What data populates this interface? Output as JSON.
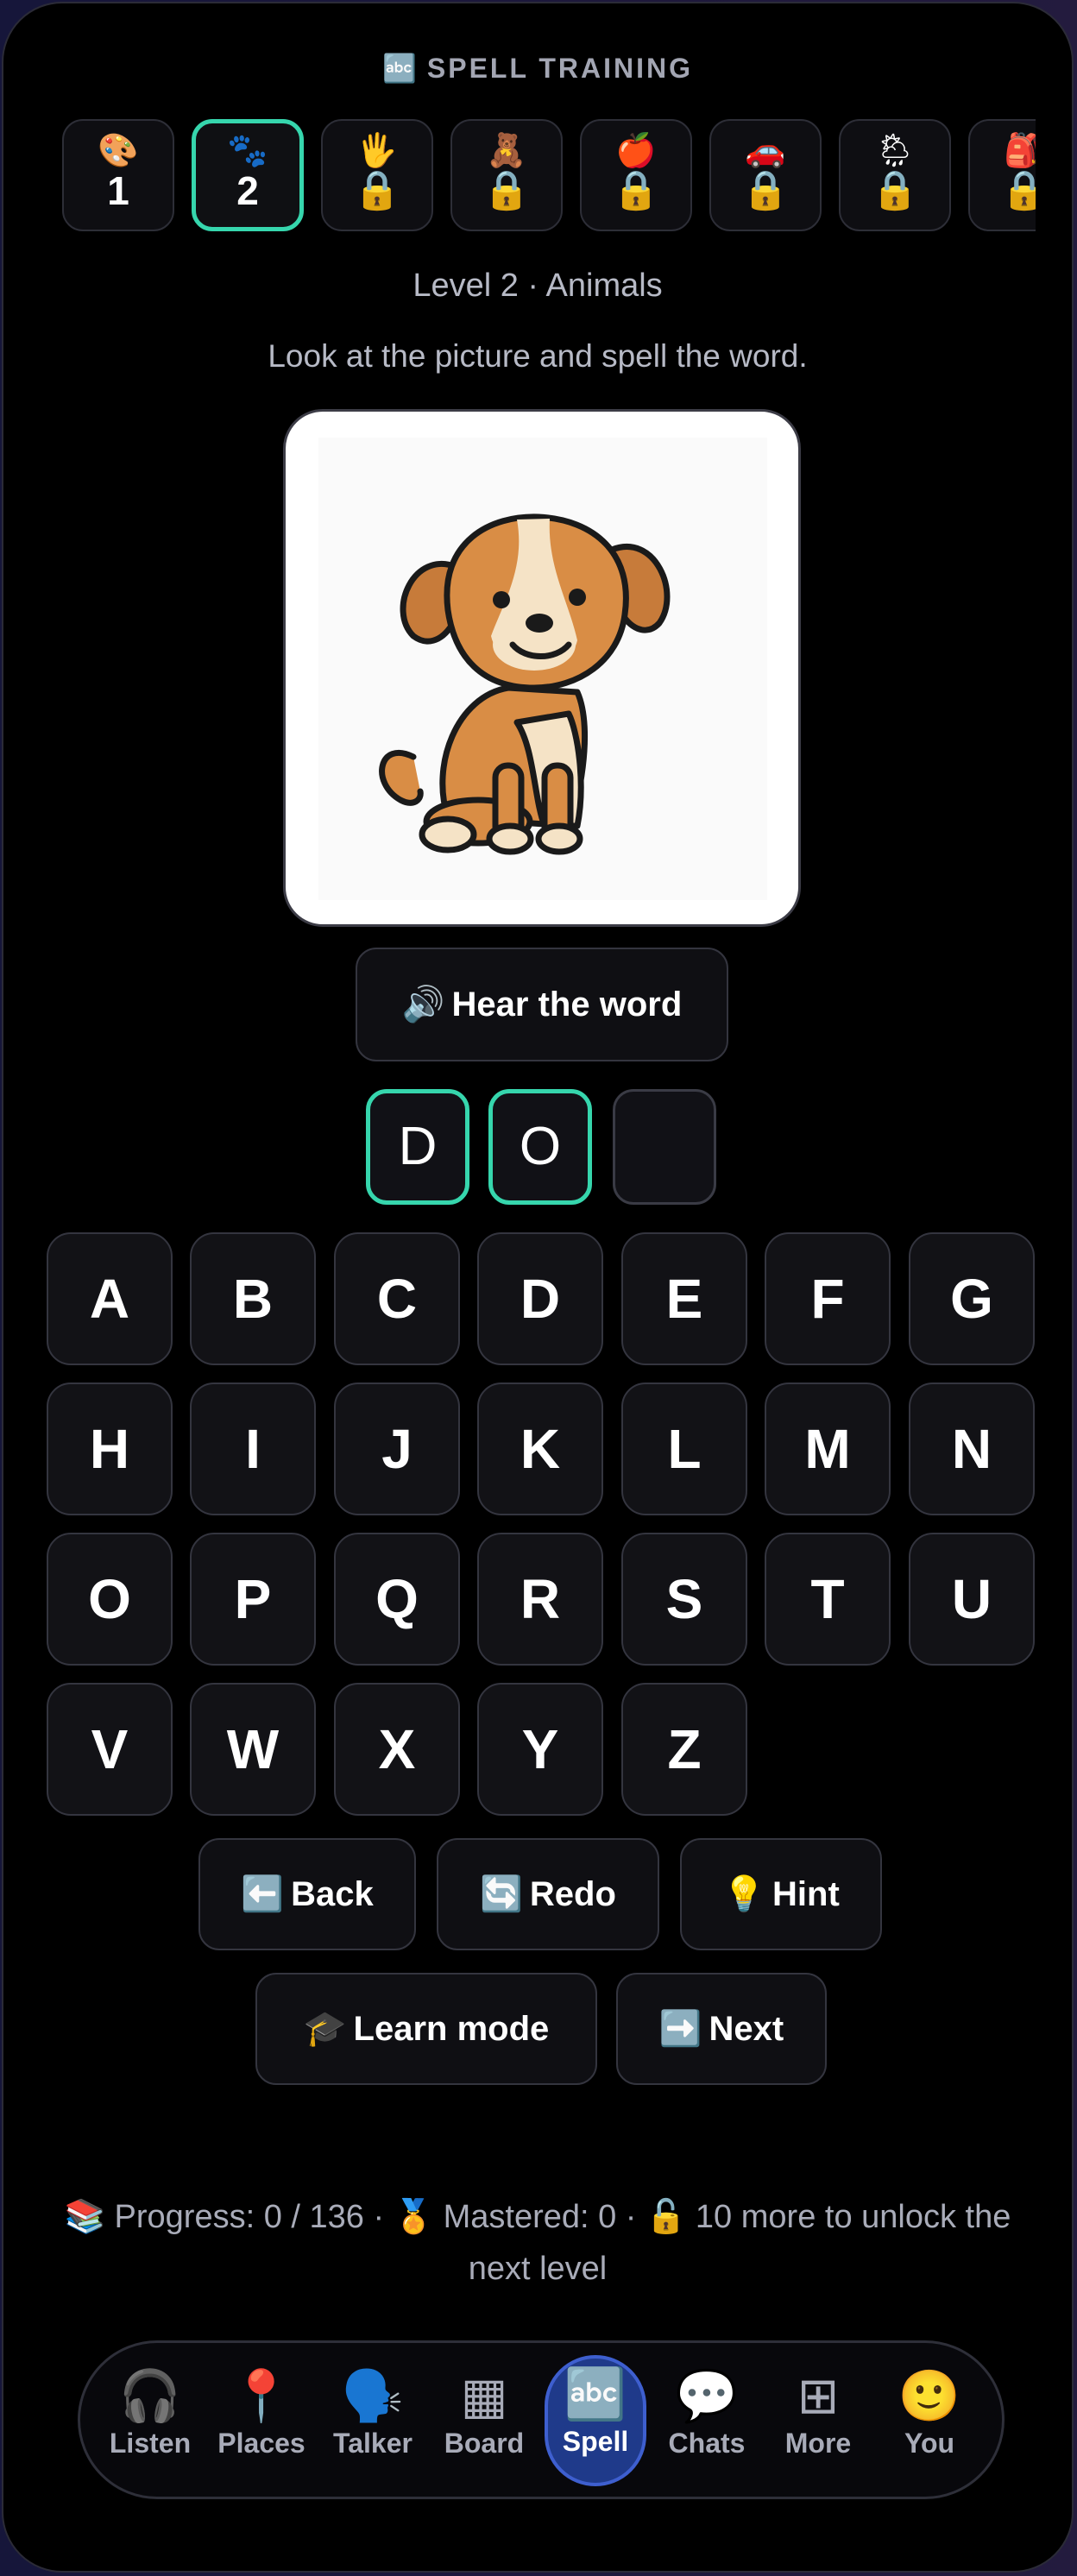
{
  "header": {
    "icon": "🔤",
    "title": "SPELL TRAINING"
  },
  "levels": [
    {
      "emoji": "🎨",
      "label": "1"
    },
    {
      "emoji": "🐾",
      "label": "2"
    },
    {
      "emoji": "🖐",
      "lock": "🔒"
    },
    {
      "emoji": "🧸",
      "lock": "🔒"
    },
    {
      "emoji": "🍎",
      "lock": "🔒"
    },
    {
      "emoji": "🚗",
      "lock": "🔒"
    },
    {
      "emoji": "🌦",
      "lock": "🔒"
    },
    {
      "emoji": "🎒",
      "lock": "🔒"
    }
  ],
  "level_title": "Level 2 · Animals",
  "instruction": "Look at the picture and spell the word.",
  "picture": {
    "icon": "dog-picture"
  },
  "hear_button": {
    "icon": "🔊",
    "label": "Hear the word"
  },
  "answer_slots": [
    "D",
    "O",
    ""
  ],
  "keyboard": [
    "A",
    "B",
    "C",
    "D",
    "E",
    "F",
    "G",
    "H",
    "I",
    "J",
    "K",
    "L",
    "M",
    "N",
    "O",
    "P",
    "Q",
    "R",
    "S",
    "T",
    "U",
    "V",
    "W",
    "X",
    "Y",
    "Z"
  ],
  "actions": {
    "back": {
      "icon": "⬅️",
      "label": "Back"
    },
    "redo": {
      "icon": "🔄",
      "label": "Redo"
    },
    "hint": {
      "icon": "💡",
      "label": "Hint"
    },
    "learn": {
      "icon": "🎓",
      "label": "Learn mode"
    },
    "next": {
      "icon": "➡️",
      "label": "Next"
    }
  },
  "progress": {
    "books_icon": "📚",
    "progress_text": "Progress: 0 / 136",
    "medal_icon": "🏅",
    "mastered_text": "Mastered: 0",
    "unlock_icon": "🔓",
    "unlock_text": "10 more to unlock the next level"
  },
  "nav": [
    {
      "icon": "🎧",
      "label": "Listen"
    },
    {
      "icon": "📍",
      "label": "Places"
    },
    {
      "icon": "🗣️",
      "label": "Talker"
    },
    {
      "icon": "▦",
      "label": "Board"
    },
    {
      "icon": "🔤",
      "label": "Spell"
    },
    {
      "icon": "💬",
      "label": "Chats"
    },
    {
      "icon": "⊞",
      "label": "More"
    },
    {
      "icon": "🙂",
      "label": "You"
    }
  ],
  "colors": {
    "accent": "#36d6ad",
    "nav_active": "#1f3a8a",
    "background": "#000000"
  }
}
